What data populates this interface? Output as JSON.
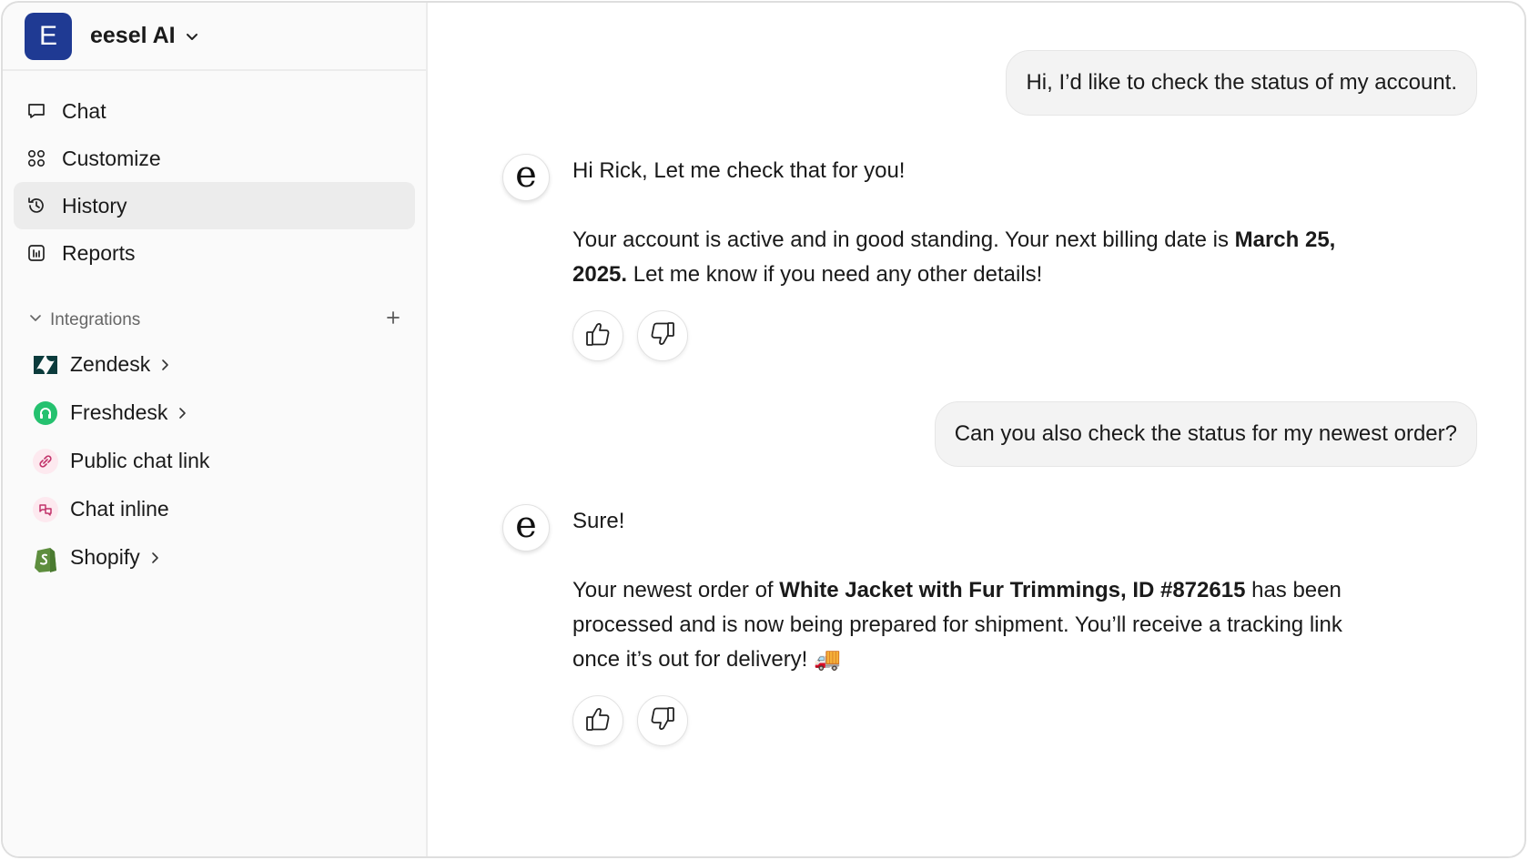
{
  "workspace": {
    "logo_letter": "E",
    "name": "eesel AI",
    "brand_color": "#1f3a93"
  },
  "nav": {
    "items": [
      {
        "label": "Chat",
        "icon": "chat-bubble-icon"
      },
      {
        "label": "Customize",
        "icon": "grid-icon"
      },
      {
        "label": "History",
        "icon": "history-icon",
        "active": true
      },
      {
        "label": "Reports",
        "icon": "reports-icon"
      }
    ]
  },
  "integrations": {
    "header": "Integrations",
    "items": [
      {
        "label": "Zendesk",
        "icon": "zendesk-icon",
        "has_chevron": true
      },
      {
        "label": "Freshdesk",
        "icon": "freshdesk-icon",
        "has_chevron": true
      },
      {
        "label": "Public chat link",
        "icon": "link-icon",
        "has_chevron": false
      },
      {
        "label": "Chat inline",
        "icon": "chat-inline-icon",
        "has_chevron": false
      },
      {
        "label": "Shopify",
        "icon": "shopify-icon",
        "has_chevron": true
      }
    ]
  },
  "chat": {
    "user_msg_1": "Hi, I’d like to check the status of my account.",
    "bot_msg_1": {
      "avatar": "e",
      "line1": "Hi Rick, Let me check that for you!",
      "line2_a": "Your account is active and in good standing. Your next billing date is ",
      "line2_bold": "March 25, 2025.",
      "line2_b": " Let me know if you need any other details!"
    },
    "user_msg_2": "Can you also check the status for my newest order?",
    "bot_msg_2": {
      "avatar": "e",
      "line1": "Sure!",
      "line2_a": "Your newest order of ",
      "line2_bold": "White Jacket with Fur Trimmings, ID #872615",
      "line2_b": " has been processed and is now being prepared for shipment. You’ll receive a tracking link once it’s out for delivery! ",
      "emoji": "🚚"
    }
  }
}
